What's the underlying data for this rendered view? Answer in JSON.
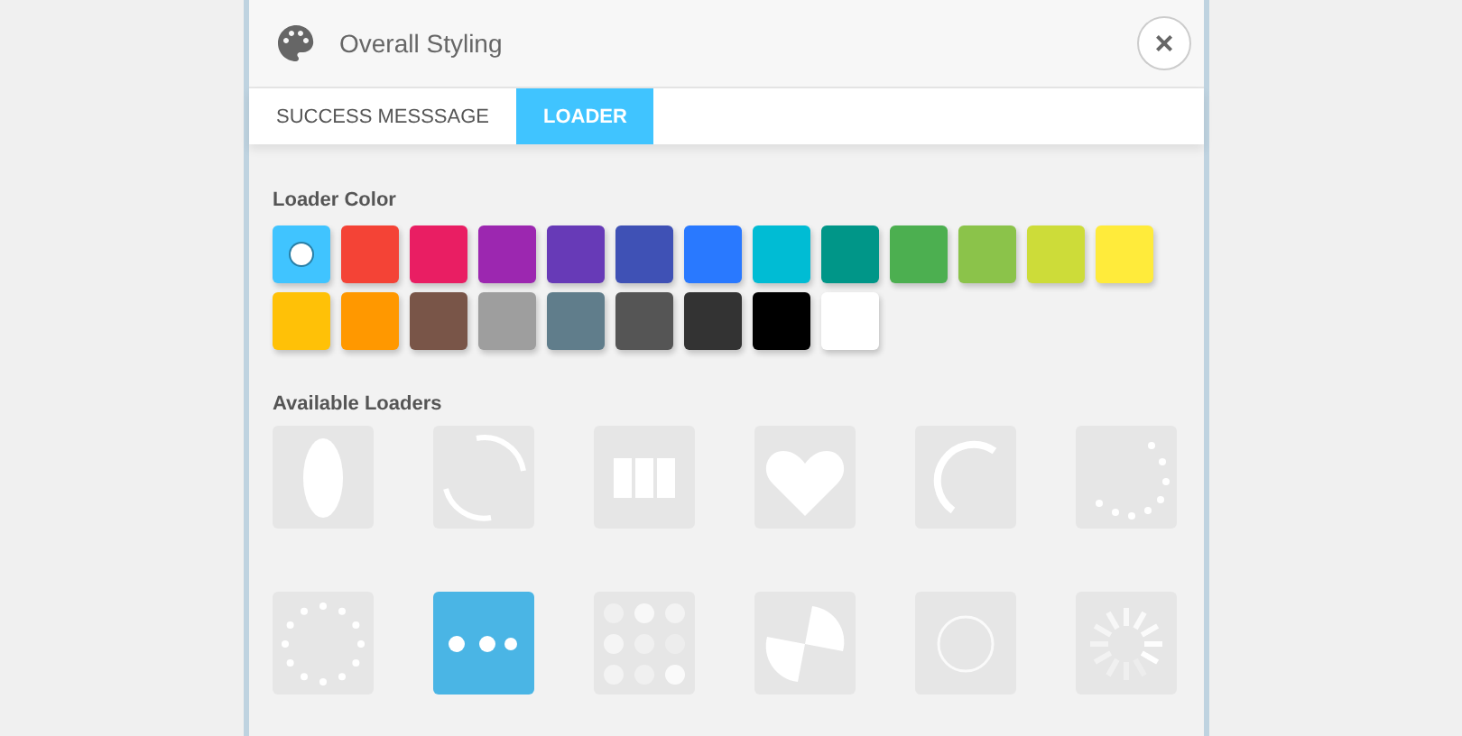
{
  "header": {
    "title": "Overall Styling",
    "close_label": "×"
  },
  "tabs": [
    {
      "label": "SUCCESS MESSSAGE",
      "selected": false
    },
    {
      "label": "LOADER",
      "selected": true
    }
  ],
  "loader_color": {
    "label": "Loader Color",
    "swatches": [
      {
        "color": "#40c4ff",
        "selected": true
      },
      {
        "color": "#f44336",
        "selected": false
      },
      {
        "color": "#e91e63",
        "selected": false
      },
      {
        "color": "#9c27b0",
        "selected": false
      },
      {
        "color": "#673ab7",
        "selected": false
      },
      {
        "color": "#3f51b5",
        "selected": false
      },
      {
        "color": "#2979ff",
        "selected": false
      },
      {
        "color": "#00bcd4",
        "selected": false
      },
      {
        "color": "#009688",
        "selected": false
      },
      {
        "color": "#4caf50",
        "selected": false
      },
      {
        "color": "#8bc34a",
        "selected": false
      },
      {
        "color": "#cddc39",
        "selected": false
      },
      {
        "color": "#ffeb3b",
        "selected": false
      },
      {
        "color": "#ffc107",
        "selected": false
      },
      {
        "color": "#ff9800",
        "selected": false
      },
      {
        "color": "#795548",
        "selected": false
      },
      {
        "color": "#9e9e9e",
        "selected": false
      },
      {
        "color": "#607d8b",
        "selected": false
      },
      {
        "color": "#555555",
        "selected": false
      },
      {
        "color": "#333333",
        "selected": false
      },
      {
        "color": "#000000",
        "selected": false
      },
      {
        "color": "#ffffff",
        "selected": false
      }
    ]
  },
  "available_loaders": {
    "label": "Available Loaders",
    "loaders": [
      {
        "kind": "oval",
        "selected": false
      },
      {
        "kind": "arcs",
        "selected": false
      },
      {
        "kind": "bars",
        "selected": false
      },
      {
        "kind": "heart",
        "selected": false
      },
      {
        "kind": "arc",
        "selected": false
      },
      {
        "kind": "trail",
        "selected": false
      },
      {
        "kind": "ring-dots",
        "selected": false
      },
      {
        "kind": "three-dots",
        "selected": true
      },
      {
        "kind": "grid",
        "selected": false
      },
      {
        "kind": "pie",
        "selected": false
      },
      {
        "kind": "circle",
        "selected": false
      },
      {
        "kind": "spokes",
        "selected": false
      }
    ]
  }
}
